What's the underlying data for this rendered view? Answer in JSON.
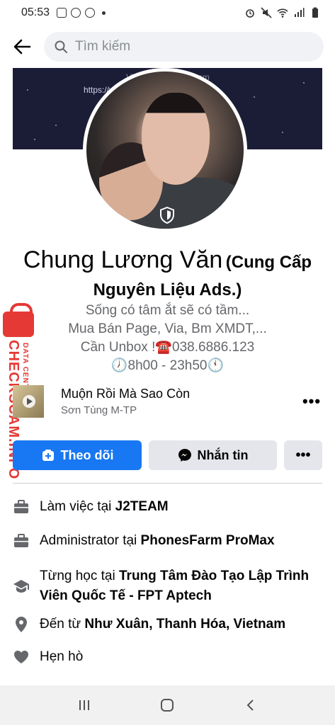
{
  "status_bar": {
    "time": "05:53"
  },
  "search": {
    "placeholder": "Tìm kiếm"
  },
  "cover": {
    "line1": "Via...... ...... ...... Scam",
    "line2": "https://w...........ngFbAds"
  },
  "profile": {
    "name": "Chung Lương Văn",
    "alt_name_line1": "(Cung Cấp",
    "alt_name_line2": "Nguyên Liệu Ads.)",
    "bio": [
      "Sống có tâm ắt sẽ có tầm...",
      "Mua Bán Page, Via, Bm XMDT,...",
      "Cần Unbox !☎️038.6886.123",
      "🕖8h00 - 23h50🕚"
    ]
  },
  "watermark": {
    "site": "CHECKSCAM.INFO",
    "tagline": "DATA CENTER"
  },
  "music": {
    "song": "Muộn Rồi Mà Sao Còn",
    "artist": "Sơn Tùng M-TP",
    "more": "•••"
  },
  "actions": {
    "follow": "Theo dõi",
    "message": "Nhắn tin",
    "more": "•••"
  },
  "details": [
    {
      "icon": "briefcase-icon",
      "prefix": "Làm việc tại ",
      "value": "J2TEAM"
    },
    {
      "icon": "briefcase-icon",
      "prefix": "Administrator tại ",
      "value": "PhonesFarm ProMax"
    },
    {
      "icon": "graduation-cap-icon",
      "prefix": "Từng học tại ",
      "value": "Trung Tâm Đào Tạo Lập Trình Viên Quốc Tế -  FPT Aptech"
    },
    {
      "icon": "location-pin-icon",
      "prefix": "Đến từ ",
      "value": "Như Xuân, Thanh Hóa, Vietnam"
    },
    {
      "icon": "heart-icon",
      "prefix": "Hẹn hò",
      "value": ""
    }
  ],
  "colors": {
    "primary": "#1877f2",
    "secondary_bg": "#e4e6eb",
    "muted_text": "#65676b",
    "watermark": "#e53935"
  }
}
